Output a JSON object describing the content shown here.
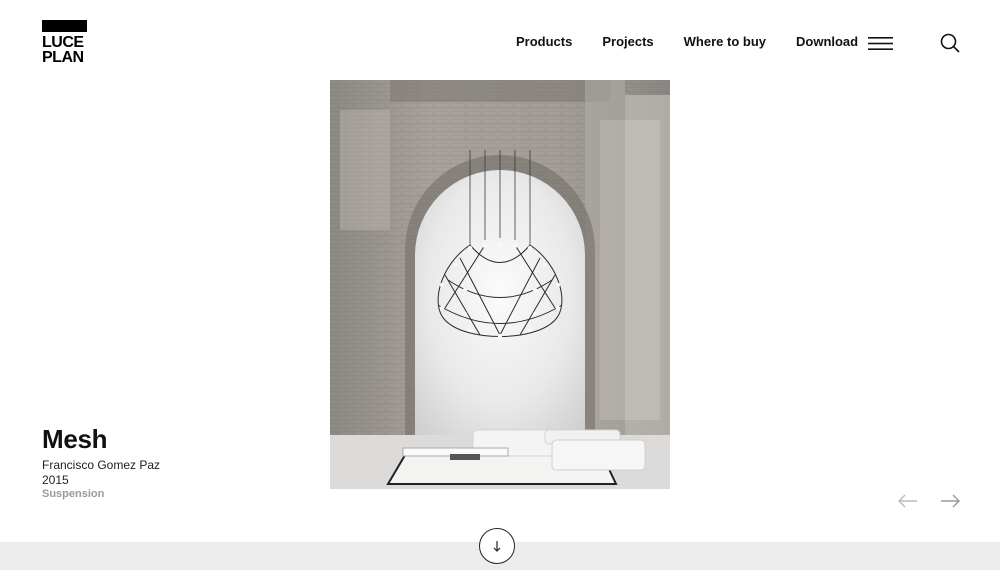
{
  "brand": {
    "logo_line1": "LUCE",
    "logo_line2": "PLAN"
  },
  "nav": {
    "items": [
      {
        "label": "Products"
      },
      {
        "label": "Projects"
      },
      {
        "label": "Where to buy"
      },
      {
        "label": "Download"
      }
    ],
    "menu_icon": "hamburger-icon",
    "search_icon": "search-icon"
  },
  "product": {
    "name": "Mesh",
    "designer": "Francisco Gomez Paz",
    "year": "2015",
    "category": "Suspension"
  },
  "carousel": {
    "prev_icon": "arrow-left-icon",
    "next_icon": "arrow-right-icon"
  },
  "scroll": {
    "icon": "arrow-down-icon"
  },
  "colors": {
    "text": "#111111",
    "muted": "#999999",
    "band": "#ececec"
  }
}
